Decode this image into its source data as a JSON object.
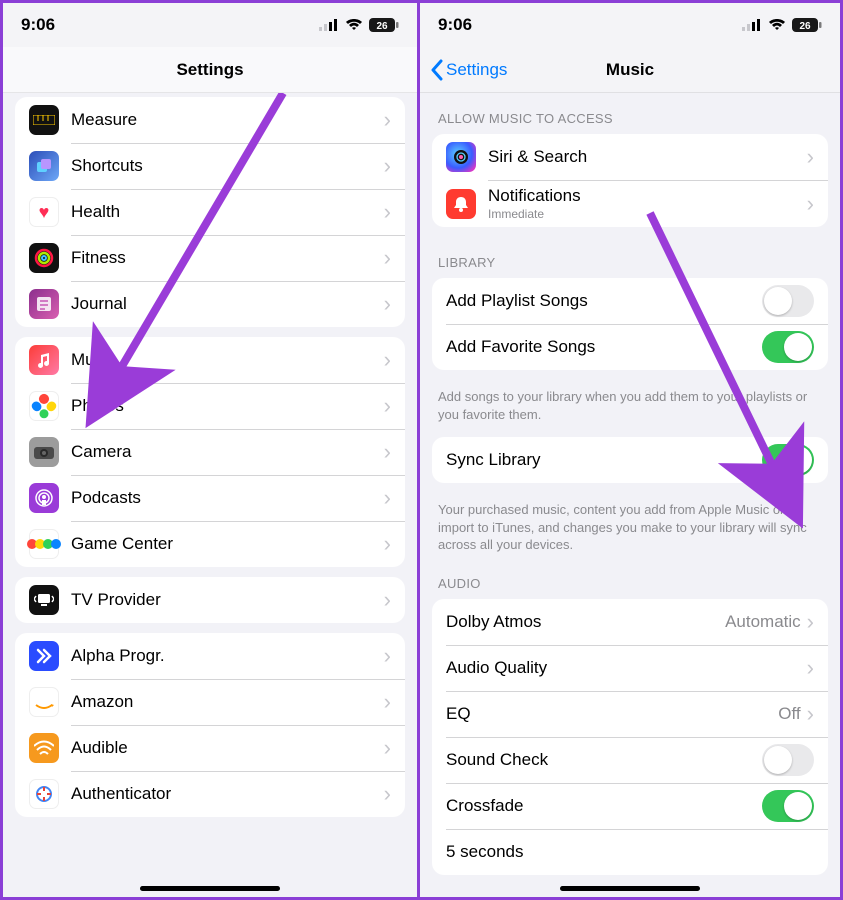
{
  "status": {
    "time": "9:06",
    "battery": "26"
  },
  "left": {
    "title": "Settings",
    "groups": [
      [
        {
          "label": "Measure",
          "icon": "measure"
        },
        {
          "label": "Shortcuts",
          "icon": "shortcut"
        },
        {
          "label": "Health",
          "icon": "health"
        },
        {
          "label": "Fitness",
          "icon": "fitness"
        },
        {
          "label": "Journal",
          "icon": "journal"
        }
      ],
      [
        {
          "label": "Music",
          "icon": "music"
        },
        {
          "label": "Photos",
          "icon": "photos"
        },
        {
          "label": "Camera",
          "icon": "camera"
        },
        {
          "label": "Podcasts",
          "icon": "podcast"
        },
        {
          "label": "Game Center",
          "icon": "gamecenter"
        }
      ],
      [
        {
          "label": "TV Provider",
          "icon": "tvprov"
        }
      ],
      [
        {
          "label": "Alpha Progr.",
          "icon": "alpha"
        },
        {
          "label": "Amazon",
          "icon": "amazon"
        },
        {
          "label": "Audible",
          "icon": "audible"
        },
        {
          "label": "Authenticator",
          "icon": "auth"
        }
      ]
    ]
  },
  "right": {
    "title": "Music",
    "back": "Settings",
    "sections": {
      "allow": {
        "header": "ALLOW MUSIC TO ACCESS",
        "rows": [
          {
            "label": "Siri & Search",
            "icon": "siri"
          },
          {
            "label": "Notifications",
            "sublabel": "Immediate",
            "icon": "notif"
          }
        ]
      },
      "library": {
        "header": "LIBRARY",
        "rows": [
          {
            "label": "Add Playlist Songs",
            "toggle": false
          },
          {
            "label": "Add Favorite Songs",
            "toggle": true
          }
        ],
        "footer": "Add songs to your library when you add them to your playlists or you favorite them."
      },
      "sync": {
        "rows": [
          {
            "label": "Sync Library",
            "toggle": true
          }
        ],
        "footer": "Your purchased music, content you add from Apple Music or import to iTunes, and changes you make to your library will sync across all your devices."
      },
      "audio": {
        "header": "AUDIO",
        "rows": [
          {
            "label": "Dolby Atmos",
            "detail": "Automatic",
            "chev": true
          },
          {
            "label": "Audio Quality",
            "chev": true
          },
          {
            "label": "EQ",
            "detail": "Off",
            "chev": true
          },
          {
            "label": "Sound Check",
            "toggle": false
          },
          {
            "label": "Crossfade",
            "toggle": true
          },
          {
            "label": "5 seconds"
          }
        ]
      }
    }
  }
}
